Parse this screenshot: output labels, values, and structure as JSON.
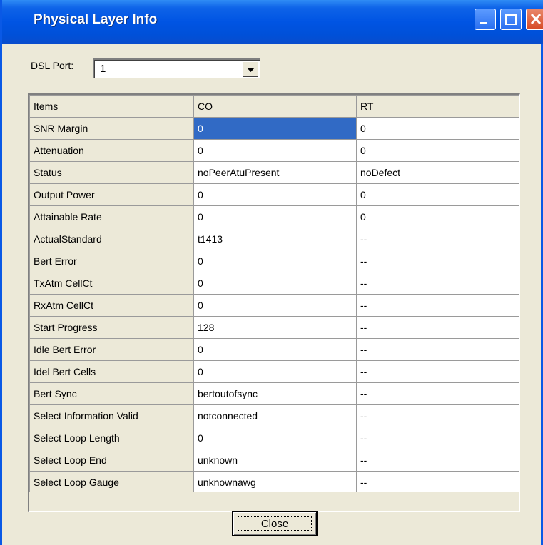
{
  "window": {
    "title": "Physical Layer Info",
    "accent_color": "#0054e3",
    "controls": [
      "minimize-icon",
      "maximize-icon",
      "close-icon"
    ]
  },
  "port": {
    "label": "DSL Port:",
    "value": "1"
  },
  "table": {
    "columns": [
      "Items",
      "CO",
      "RT"
    ],
    "rows": [
      {
        "item": "SNR Margin",
        "co": "0",
        "rt": "0"
      },
      {
        "item": "Attenuation",
        "co": "0",
        "rt": "0"
      },
      {
        "item": "Status",
        "co": "noPeerAtuPresent",
        "rt": "noDefect"
      },
      {
        "item": "Output Power",
        "co": "0",
        "rt": "0"
      },
      {
        "item": "Attainable Rate",
        "co": "0",
        "rt": "0"
      },
      {
        "item": "ActualStandard",
        "co": "t1413",
        "rt": "--"
      },
      {
        "item": "Bert Error",
        "co": "0",
        "rt": "--"
      },
      {
        "item": "TxAtm CellCt",
        "co": "0",
        "rt": "--"
      },
      {
        "item": "RxAtm CellCt",
        "co": "0",
        "rt": "--"
      },
      {
        "item": "Start Progress",
        "co": "128",
        "rt": "--"
      },
      {
        "item": "Idle Bert Error",
        "co": "0",
        "rt": "--"
      },
      {
        "item": "Idel Bert Cells",
        "co": "0",
        "rt": "--"
      },
      {
        "item": "Bert Sync",
        "co": "bertoutofsync",
        "rt": "--"
      },
      {
        "item": "Select Information Valid",
        "co": "notconnected",
        "rt": "--"
      },
      {
        "item": "Select Loop Length",
        "co": "0",
        "rt": "--"
      },
      {
        "item": "Select Loop End",
        "co": "unknown",
        "rt": "--"
      },
      {
        "item": "Select Loop Gauge",
        "co": "unknownawg",
        "rt": "--"
      }
    ],
    "selected_color": "#316ac5"
  },
  "buttons": {
    "close_label": "Close"
  }
}
